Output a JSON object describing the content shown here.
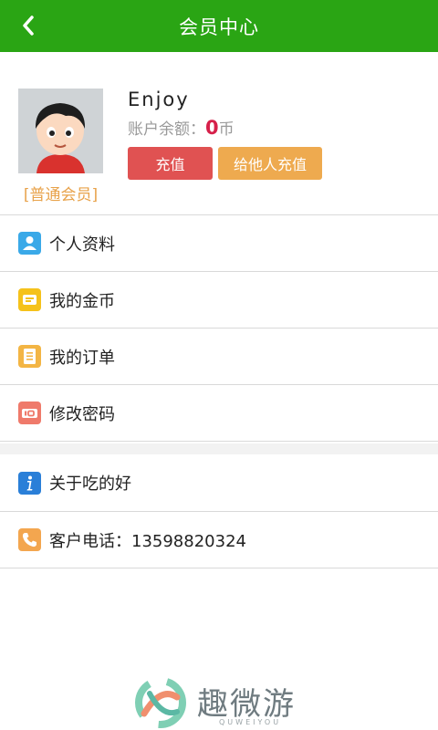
{
  "header": {
    "title": "会员中心",
    "back_icon": "chevron-left-icon"
  },
  "profile": {
    "username": "Enjoy",
    "balance_label": "账户余额：",
    "balance_value": "0",
    "balance_unit": "币",
    "member_level": "[普通会员]",
    "recharge_button": "充值",
    "gift_recharge_button": "给他人充值"
  },
  "menu_group1": [
    {
      "label": "个人资料",
      "icon": "user-profile-icon",
      "color": "#3aa9e8"
    },
    {
      "label": "我的金币",
      "icon": "coins-icon",
      "color": "#f5c21b"
    },
    {
      "label": "我的订单",
      "icon": "order-list-icon",
      "color": "#f3b544"
    },
    {
      "label": "修改密码",
      "icon": "password-icon",
      "color": "#ef7a6b"
    }
  ],
  "menu_group2": [
    {
      "label": "关于吃的好",
      "icon": "info-icon",
      "color": "#2a7fd8"
    },
    {
      "label": "客户电话：13598820324",
      "icon": "phone-icon",
      "color": "#f3a64f"
    }
  ],
  "watermark": {
    "brand": "趣微游",
    "sub": "QUWEIYOU"
  },
  "colors": {
    "header_bg": "#2aa514",
    "recharge": "#e05252",
    "gift": "#eeaa4f",
    "balance_num": "#d6204a",
    "level": "#e8a24a"
  }
}
